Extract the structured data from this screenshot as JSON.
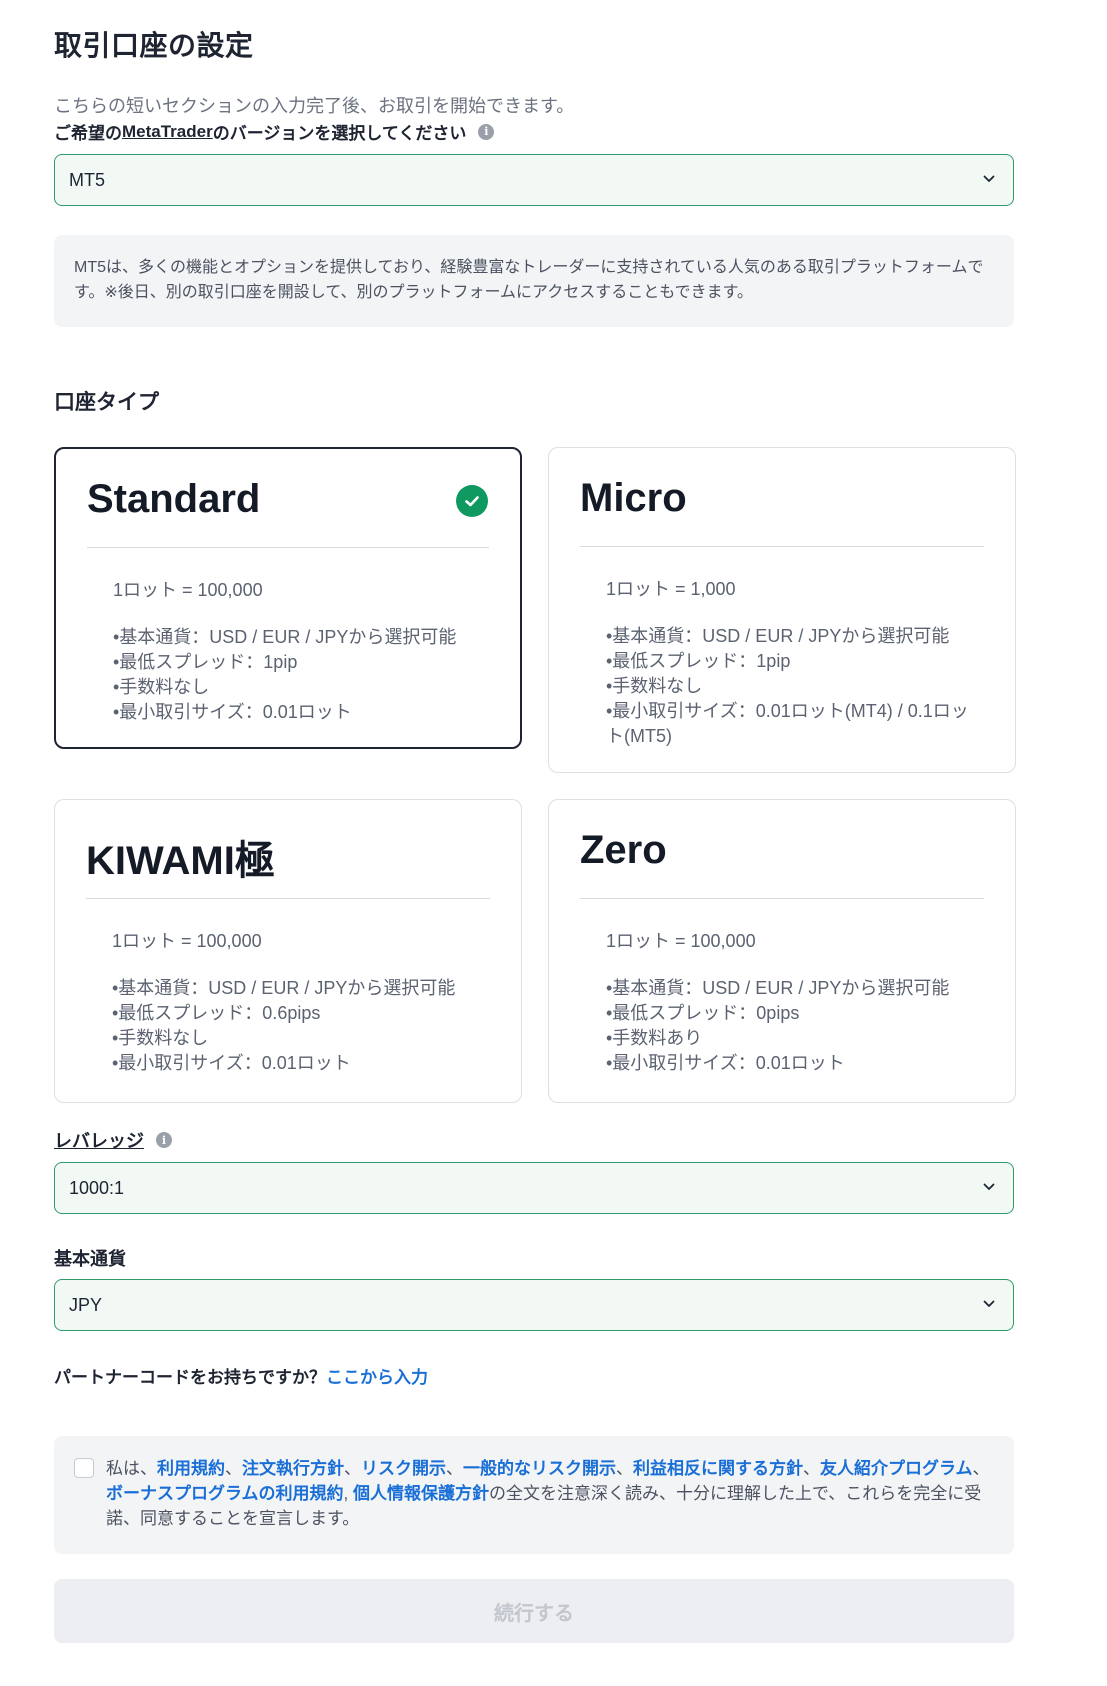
{
  "page": {
    "title": "取引口座の設定",
    "subtitle": "こちらの短いセクションの入力完了後、お取引を開始できます。"
  },
  "platform": {
    "label_prefix": "ご希望の",
    "label_link": "MetaTrader",
    "label_suffix": "のバージョンを選択してください",
    "info_icon": "i",
    "value": "MT5",
    "note": "MT5は、多くの機能とオプションを提供しており、経験豊富なトレーダーに支持されている人気のある取引プラットフォームです。※後日、別の取引口座を開設して、別のプラットフォームにアクセスすることもできます。"
  },
  "account_type": {
    "title": "口座タイプ",
    "cards": [
      {
        "name": "Standard",
        "selected": true,
        "lot": "1ロット = 100,000",
        "features": [
          "•基本通貨：USD / EUR / JPYから選択可能",
          "•最低スプレッド：1pip",
          "•手数料なし",
          "•最小取引サイズ：0.01ロット"
        ]
      },
      {
        "name": "Micro",
        "selected": false,
        "lot": "1ロット = 1,000",
        "features": [
          "•基本通貨：USD / EUR / JPYから選択可能",
          "•最低スプレッド：1pip",
          "•手数料なし",
          "•最小取引サイズ：0.01ロット(MT4) / 0.1ロット(MT5)"
        ]
      },
      {
        "name": "KIWAMI極",
        "selected": false,
        "lot": "1ロット = 100,000",
        "features": [
          "•基本通貨：USD / EUR / JPYから選択可能",
          "•最低スプレッド：0.6pips",
          "•手数料なし",
          "•最小取引サイズ：0.01ロット"
        ]
      },
      {
        "name": "Zero",
        "selected": false,
        "lot": "1ロット = 100,000",
        "features": [
          "•基本通貨：USD / EUR / JPYから選択可能",
          "•最低スプレッド：0pips",
          "•手数料あり",
          "•最小取引サイズ：0.01ロット"
        ]
      }
    ]
  },
  "leverage": {
    "label": "レバレッジ",
    "info_icon": "i",
    "value": "1000:1"
  },
  "currency": {
    "label": "基本通貨",
    "value": "JPY"
  },
  "partner": {
    "text": "パートナーコードをお持ちですか？",
    "link": "ここから入力"
  },
  "agreement": {
    "prefix": "私は、",
    "links": [
      "利用規約",
      "注文執行方針",
      "リスク開示",
      "一般的なリスク開示",
      "利益相反に関する方針",
      "友人紹介プログラム",
      "ボーナスプログラムの利用規約",
      "個人情報保護方針"
    ],
    "separators": [
      "、",
      "、",
      "、",
      "、",
      "、",
      "、",
      ", "
    ],
    "suffix": "の全文を注意深く読み、十分に理解した上で、これらを完全に受諾、同意することを宣言します。",
    "checked": false
  },
  "continue_button": {
    "label": "続行する",
    "enabled": false
  },
  "colors": {
    "accent_green": "#0f9960",
    "link_blue": "#1a6fd6",
    "field_border": "#2f9a6a"
  }
}
